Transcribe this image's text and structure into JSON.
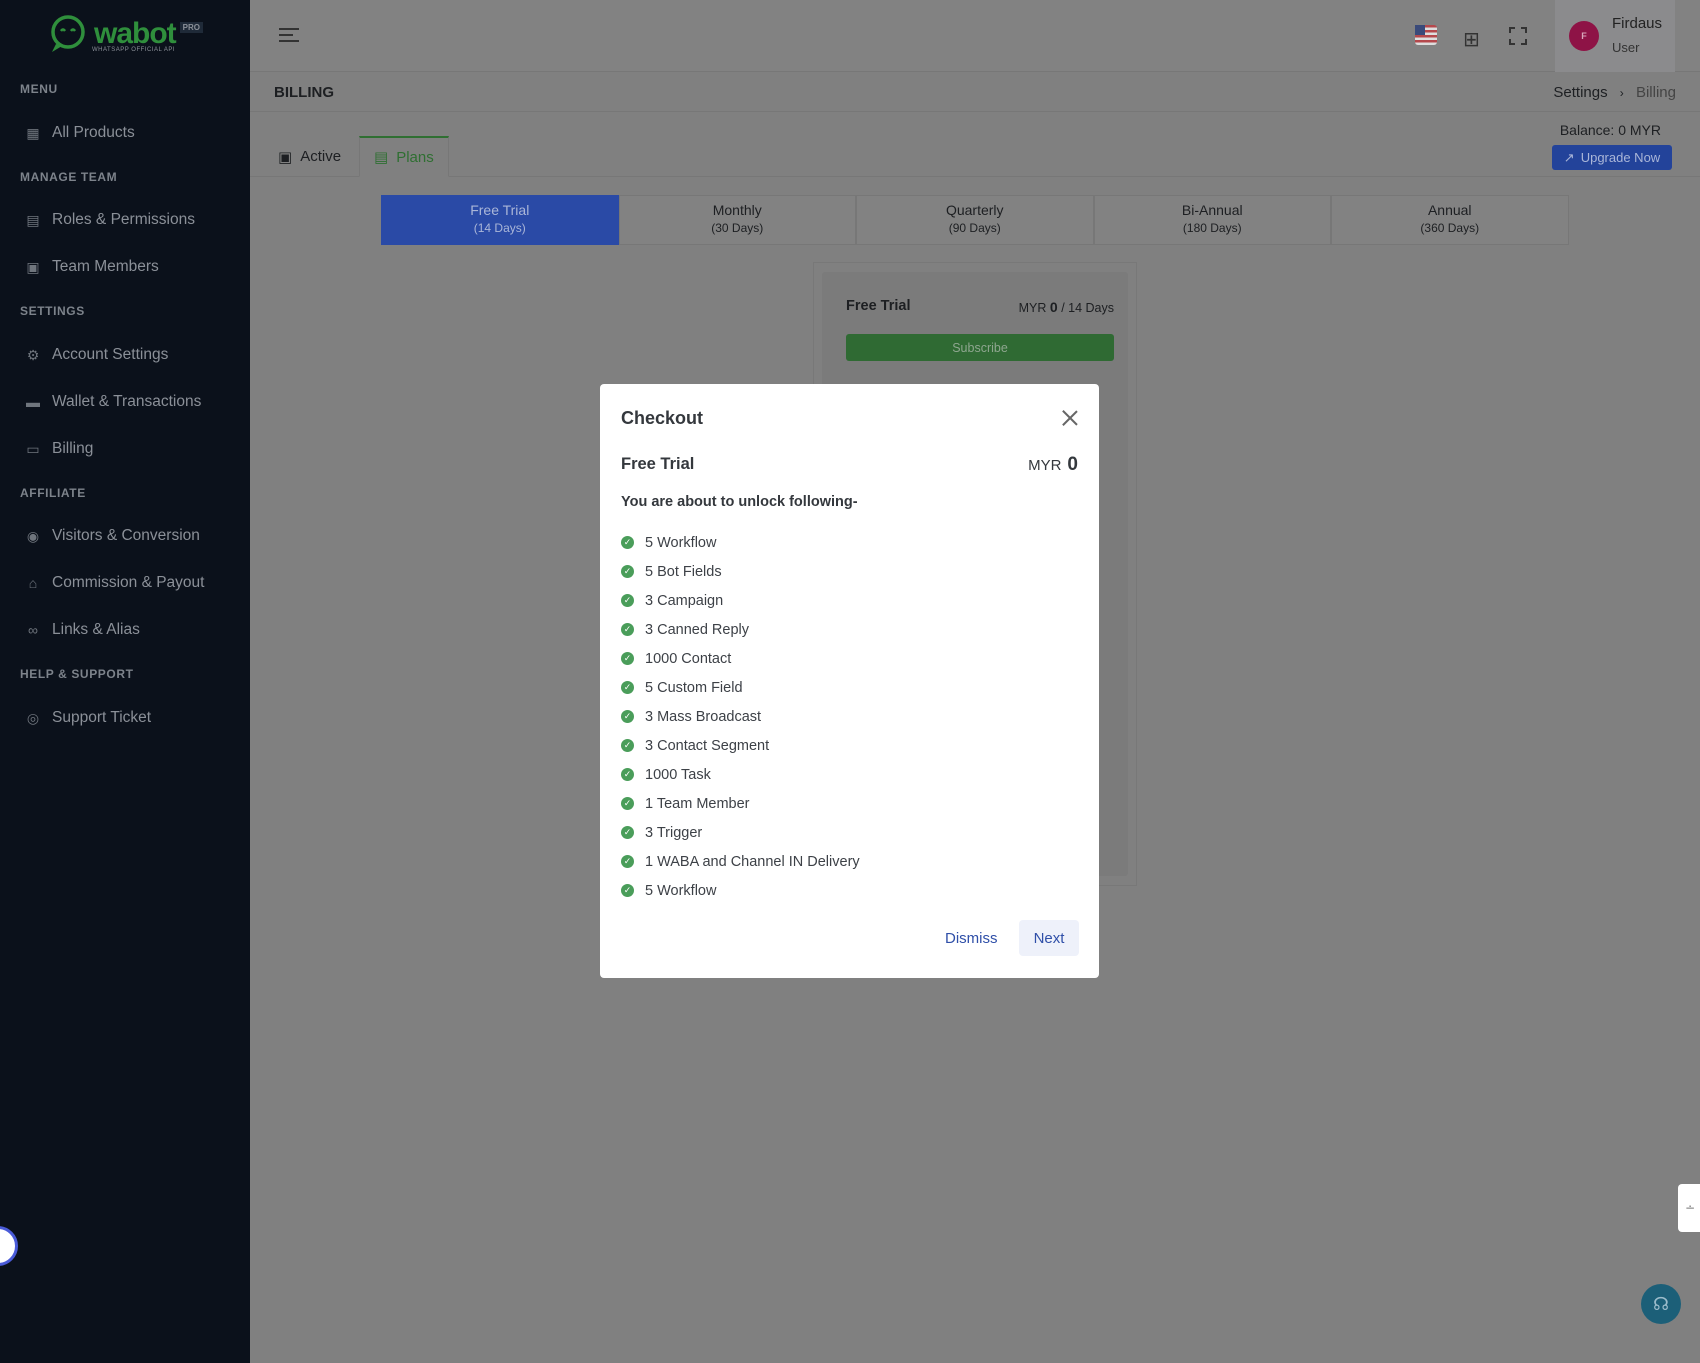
{
  "brand": {
    "name": "wabot",
    "badge": "PRO",
    "tagline": "WHATSAPP OFFICIAL API",
    "accent": "#2f8f3c"
  },
  "sidebar": {
    "sections": [
      {
        "title": "MENU",
        "items": [
          {
            "label": "All Products",
            "icon": "grid-icon"
          }
        ]
      },
      {
        "title": "MANAGE TEAM",
        "items": [
          {
            "label": "Roles & Permissions",
            "icon": "clipboard-icon"
          },
          {
            "label": "Team Members",
            "icon": "contacts-icon"
          }
        ]
      },
      {
        "title": "SETTINGS",
        "items": [
          {
            "label": "Account Settings",
            "icon": "gear-icon"
          },
          {
            "label": "Wallet & Transactions",
            "icon": "wallet-icon"
          },
          {
            "label": "Billing",
            "icon": "credit-card-icon"
          }
        ]
      },
      {
        "title": "AFFILIATE",
        "items": [
          {
            "label": "Visitors & Conversion",
            "icon": "eye-icon"
          },
          {
            "label": "Commission & Payout",
            "icon": "bank-icon"
          },
          {
            "label": "Links & Alias",
            "icon": "link-icon"
          }
        ]
      },
      {
        "title": "HELP & SUPPORT",
        "items": [
          {
            "label": "Support Ticket",
            "icon": "lifebuoy-icon"
          }
        ]
      }
    ]
  },
  "header": {
    "user": {
      "initial": "F",
      "name": "Firdaus",
      "role": "User"
    }
  },
  "page": {
    "title": "BILLING",
    "breadcrumb": [
      "Settings",
      "Billing"
    ],
    "balance": "Balance: 0 MYR",
    "upgrade_label": "Upgrade Now"
  },
  "tabs": [
    {
      "label": "Active"
    },
    {
      "label": "Plans"
    }
  ],
  "plans": [
    {
      "name": "Free Trial",
      "period": "(14 Days)"
    },
    {
      "name": "Monthly",
      "period": "(30 Days)"
    },
    {
      "name": "Quarterly",
      "period": "(90 Days)"
    },
    {
      "name": "Bi-Annual",
      "period": "(180 Days)"
    },
    {
      "name": "Annual",
      "period": "(360 Days)"
    }
  ],
  "card": {
    "title": "Free Trial",
    "currency": "MYR",
    "amount": "0",
    "duration": "/ 14 Days",
    "subscribe_label": "Subscribe"
  },
  "modal": {
    "title": "Checkout",
    "plan": "Free Trial",
    "currency": "MYR",
    "amount": "0",
    "subtitle": "You are about to unlock following-",
    "features": [
      "5 Workflow",
      "5 Bot Fields",
      "3 Campaign",
      "3 Canned Reply",
      "1000 Contact",
      "5 Custom Field",
      "3 Mass Broadcast",
      "3 Contact Segment",
      "1000 Task",
      "1 Team Member",
      "3 Trigger",
      "1 WABA and Channel IN Delivery",
      "5 Workflow"
    ],
    "dismiss_label": "Dismiss",
    "next_label": "Next"
  }
}
